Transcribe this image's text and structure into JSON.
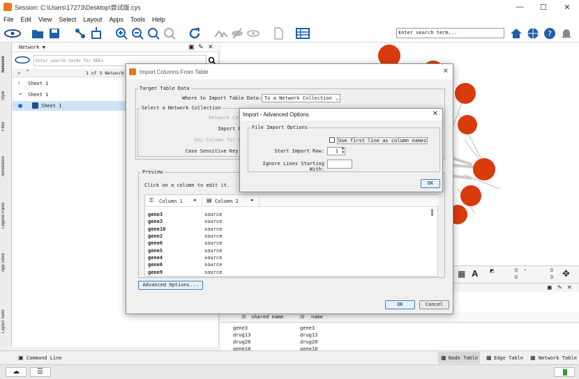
{
  "window": {
    "title": "Session: C:\\Users\\17273\\Desktop\\尝试版.cys",
    "min": "—",
    "max": "☐",
    "close": "✕"
  },
  "menu": [
    "File",
    "Edit",
    "View",
    "Select",
    "Layout",
    "Apps",
    "Tools",
    "Help"
  ],
  "search": {
    "placeholder": "Enter search term..."
  },
  "left_tabs": [
    "Network",
    "Style",
    "Filter",
    "Annotation",
    "Legend Panel",
    "App Store",
    "Layout Tools"
  ],
  "network_panel": {
    "title": "Network ▼",
    "search_placeholder": "Enter search terms for NDEx",
    "count": "1 of 5 Network",
    "items": [
      "Sheet 1",
      "Sheet 1",
      "Sheet 1"
    ]
  },
  "import_dialog": {
    "title": "Import Columns From Table",
    "target_legend": "Target Table Data",
    "where_label": "Where to Import Table Data:",
    "where_value": "To a Network Collection",
    "select_legend": "Select a Network Collection",
    "network_coll_label": "Network Coll",
    "import_label": "Import Da",
    "key_label": "Key Column for Ne",
    "case_label": "Case Sensitive Key V",
    "preview_legend": "Preview",
    "preview_hint": "Click on a column to edit it.",
    "col1": "Column 1",
    "col2": "Column 2",
    "rows": [
      [
        "gene3",
        "source"
      ],
      [
        "gene3",
        "source"
      ],
      [
        "gene10",
        "source"
      ],
      [
        "gene2",
        "source"
      ],
      [
        "gene6",
        "source"
      ],
      [
        "gene5",
        "source"
      ],
      [
        "gene4",
        "source"
      ],
      [
        "gene6",
        "source"
      ],
      [
        "gene9",
        "source"
      ]
    ],
    "advanced": "Advanced Options...",
    "ok": "OK",
    "cancel": "Cancel"
  },
  "adv_dialog": {
    "title": "Import - Advanced Options",
    "legend": "File Import Options",
    "checkbox": "Use first line as column names",
    "start_row_label": "Start Import Row:",
    "start_row_value": "1",
    "ignore_label": "Ignore Lines Starting With:",
    "ok": "OK"
  },
  "mini_panel": {
    "v1": "0",
    "v2": "0",
    "v3": "0",
    "v4": "0"
  },
  "table_panel": {
    "headers": [
      "shared name",
      "name"
    ],
    "rows": [
      [
        "gene3",
        "gene3"
      ],
      [
        "drug13",
        "drug13"
      ],
      [
        "drug20",
        "drug20"
      ],
      [
        "gene10",
        "gene10"
      ]
    ]
  },
  "bottom_tabs": {
    "command": "Command Line",
    "node": "Node Table",
    "edge": "Edge Table",
    "network": "Network Table"
  },
  "colors": {
    "node": "#d93b0b",
    "accent": "#3a7ec7"
  }
}
